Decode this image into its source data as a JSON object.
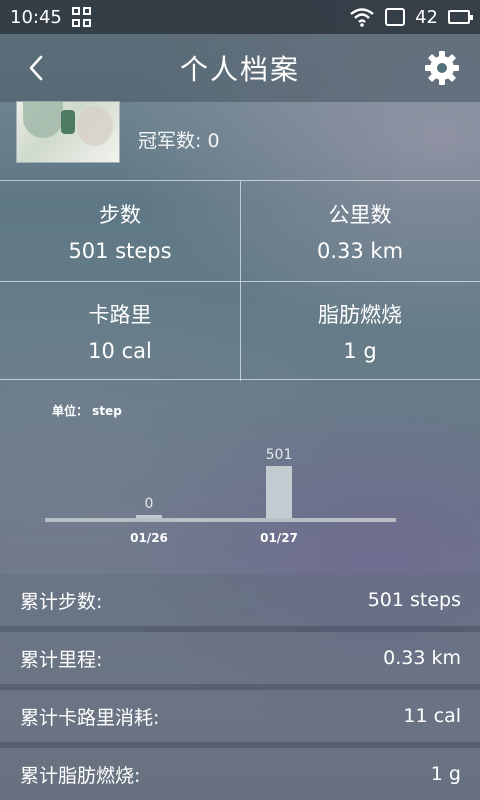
{
  "status_bar": {
    "time": "10:45",
    "battery_level": "42",
    "icons": [
      "grid-icon",
      "wifi-icon",
      "sim-icon",
      "battery-icon"
    ]
  },
  "header": {
    "title": "个人档案",
    "back_icon": "chevron-left-icon",
    "settings_icon": "gear-icon"
  },
  "profile": {
    "champions_text": "冠军数: 0"
  },
  "stats": [
    {
      "label": "步数",
      "value": "501 steps"
    },
    {
      "label": "公里数",
      "value": "0.33 km"
    },
    {
      "label": "卡路里",
      "value": "10 cal"
    },
    {
      "label": "脂肪燃烧",
      "value": "1 g"
    }
  ],
  "chart_data": {
    "type": "bar",
    "unit_label": "单位： step",
    "categories": [
      "01/26",
      "01/27"
    ],
    "values": [
      0,
      501
    ],
    "data_labels": [
      "0",
      "501"
    ],
    "ylim": [
      0,
      501
    ],
    "grid": false,
    "colors": {
      "bar": "#c3cad0",
      "baseline": "#b7bec4"
    }
  },
  "totals": [
    {
      "label": "累计步数:",
      "value": "501 steps"
    },
    {
      "label": "累计里程:",
      "value": "0.33 km"
    },
    {
      "label": "累计卡路里消耗:",
      "value": "11 cal"
    },
    {
      "label": "累计脂肪燃烧:",
      "value": "1 g"
    }
  ],
  "colors": {
    "battery": "#46c84b",
    "text": "#ffffff"
  }
}
